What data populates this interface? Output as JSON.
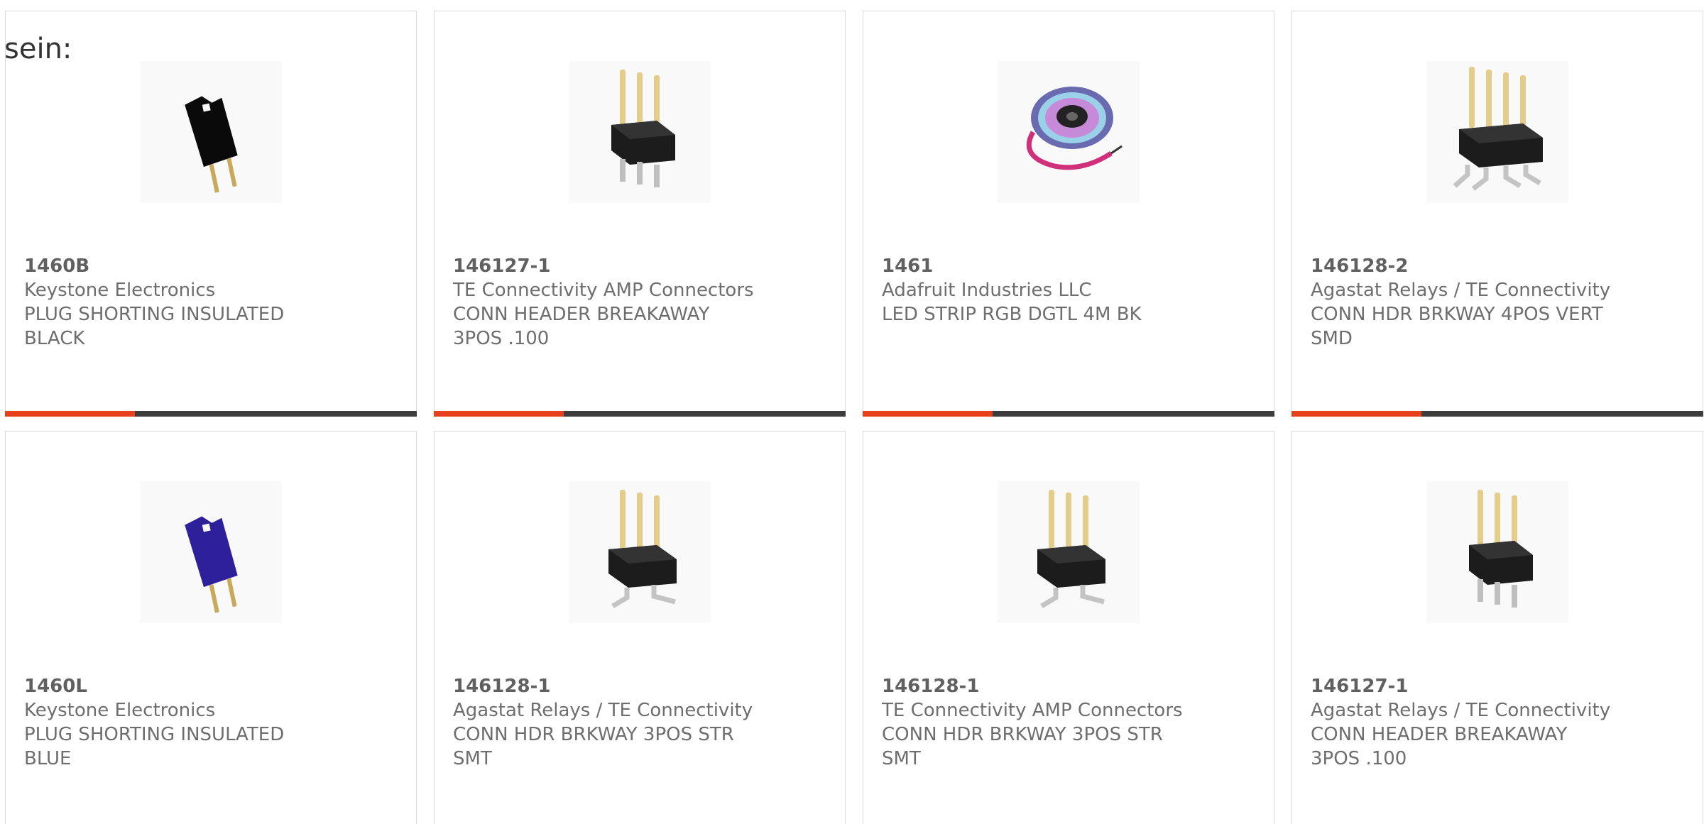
{
  "overlay_label": "sein:",
  "colors": {
    "accent_bar": "#e8401c",
    "bar": "#3c3c3c",
    "card_border": "#d9d9d9",
    "text": "#6e6e6e"
  },
  "products": [
    {
      "part_number": "1460B",
      "manufacturer": "Keystone Electronics",
      "desc_line1": "PLUG SHORTING INSULATED",
      "desc_line2": "BLACK",
      "image_icon": "black-shorting-plug-icon"
    },
    {
      "part_number": "146127-1",
      "manufacturer": "TE Connectivity AMP Connectors",
      "desc_line1": "CONN HEADER BREAKAWAY",
      "desc_line2": "3POS .100",
      "image_icon": "3pin-header-icon"
    },
    {
      "part_number": "1461",
      "manufacturer": "Adafruit Industries LLC",
      "desc_line1": "LED STRIP RGB DGTL 4M BK",
      "desc_line2": "",
      "image_icon": "led-strip-reel-icon"
    },
    {
      "part_number": "146128-2",
      "manufacturer": "Agastat Relays / TE Connectivity",
      "desc_line1": "CONN HDR BRKWAY 4POS VERT",
      "desc_line2": "SMD",
      "image_icon": "4pin-smd-header-icon"
    },
    {
      "part_number": "1460L",
      "manufacturer": "Keystone Electronics",
      "desc_line1": "PLUG SHORTING INSULATED",
      "desc_line2": "BLUE",
      "image_icon": "blue-shorting-plug-icon"
    },
    {
      "part_number": "146128-1",
      "manufacturer": "Agastat Relays / TE Connectivity",
      "desc_line1": "CONN HDR BRKWAY 3POS STR",
      "desc_line2": "SMT",
      "image_icon": "3pin-smt-header-icon"
    },
    {
      "part_number": "146128-1",
      "manufacturer": "TE Connectivity AMP Connectors",
      "desc_line1": "CONN HDR BRKWAY 3POS STR",
      "desc_line2": "SMT",
      "image_icon": "3pin-smt-header-icon"
    },
    {
      "part_number": "146127-1",
      "manufacturer": "Agastat Relays / TE Connectivity",
      "desc_line1": "CONN HEADER BREAKAWAY",
      "desc_line2": "3POS .100",
      "image_icon": "3pin-header-icon"
    }
  ]
}
